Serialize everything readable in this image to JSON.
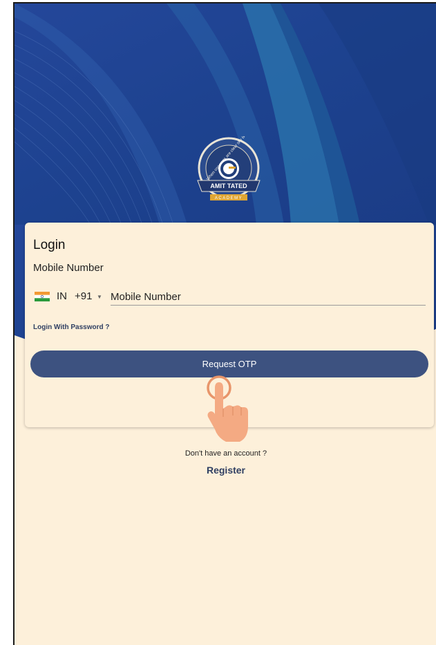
{
  "colors": {
    "hero_background": "#1f4494",
    "card_background": "#fdf0da",
    "primary_button": "#3d5280",
    "link_text": "#2f3f62"
  },
  "logo": {
    "ring_text": "When concepts are clear sky is the limit",
    "banner_text": "AMIT TATED",
    "sub_text": "ACADEMY"
  },
  "login": {
    "title": "Login",
    "field_label": "Mobile Number",
    "country_code": "IN",
    "dial_code": "+91",
    "phone_placeholder": "Mobile Number",
    "password_link": "Login With Password ?",
    "request_otp_label": "Request OTP"
  },
  "footer": {
    "no_account_text": "Don't have an account ?",
    "register_label": "Register"
  },
  "icons": {
    "flag": "india-flag-icon",
    "caret": "caret-down-icon",
    "hand": "tap-hand-icon"
  }
}
